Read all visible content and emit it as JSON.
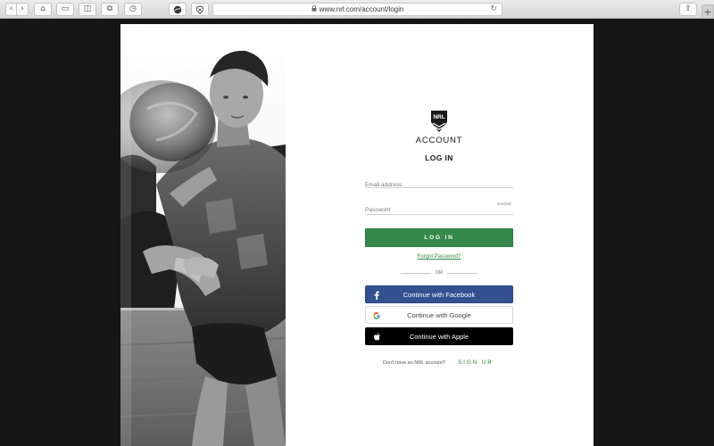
{
  "browser": {
    "url": "www.nrl.com/account/login",
    "buttons": {
      "back": "‹",
      "forward": "›",
      "home": "⌂",
      "print": "▭",
      "sidebar": "◫",
      "tabs": "⧉",
      "history": "◷",
      "share": "⇪",
      "new_tab": "+",
      "reload": "↻"
    }
  },
  "logo_text": "NRL",
  "account_title": "ACCOUNT",
  "login_title": "LOG IN",
  "form": {
    "email_placeholder": "Email address",
    "email_value": "",
    "password_placeholder": "Password",
    "password_value": "",
    "show_label": "SHOW",
    "login_button": "LOG IN",
    "forgot_password": "Forgot Password?",
    "or_label": "OR"
  },
  "social": {
    "facebook_label": "Continue with Facebook",
    "google_label": "Continue with Google",
    "apple_label": "Continue with Apple"
  },
  "signup": {
    "question": "Don't have an NRL account?",
    "link": "SIGN UP",
    "chevron": "›"
  },
  "colors": {
    "primary_green": "#35894a",
    "facebook_blue": "#33508f",
    "apple_black": "#000000",
    "link_green": "#2e8a45"
  },
  "icons": [
    "lock-icon",
    "reload-icon",
    "nrl-logo",
    "facebook-icon",
    "google-icon",
    "apple-icon",
    "chevron-right-icon"
  ]
}
